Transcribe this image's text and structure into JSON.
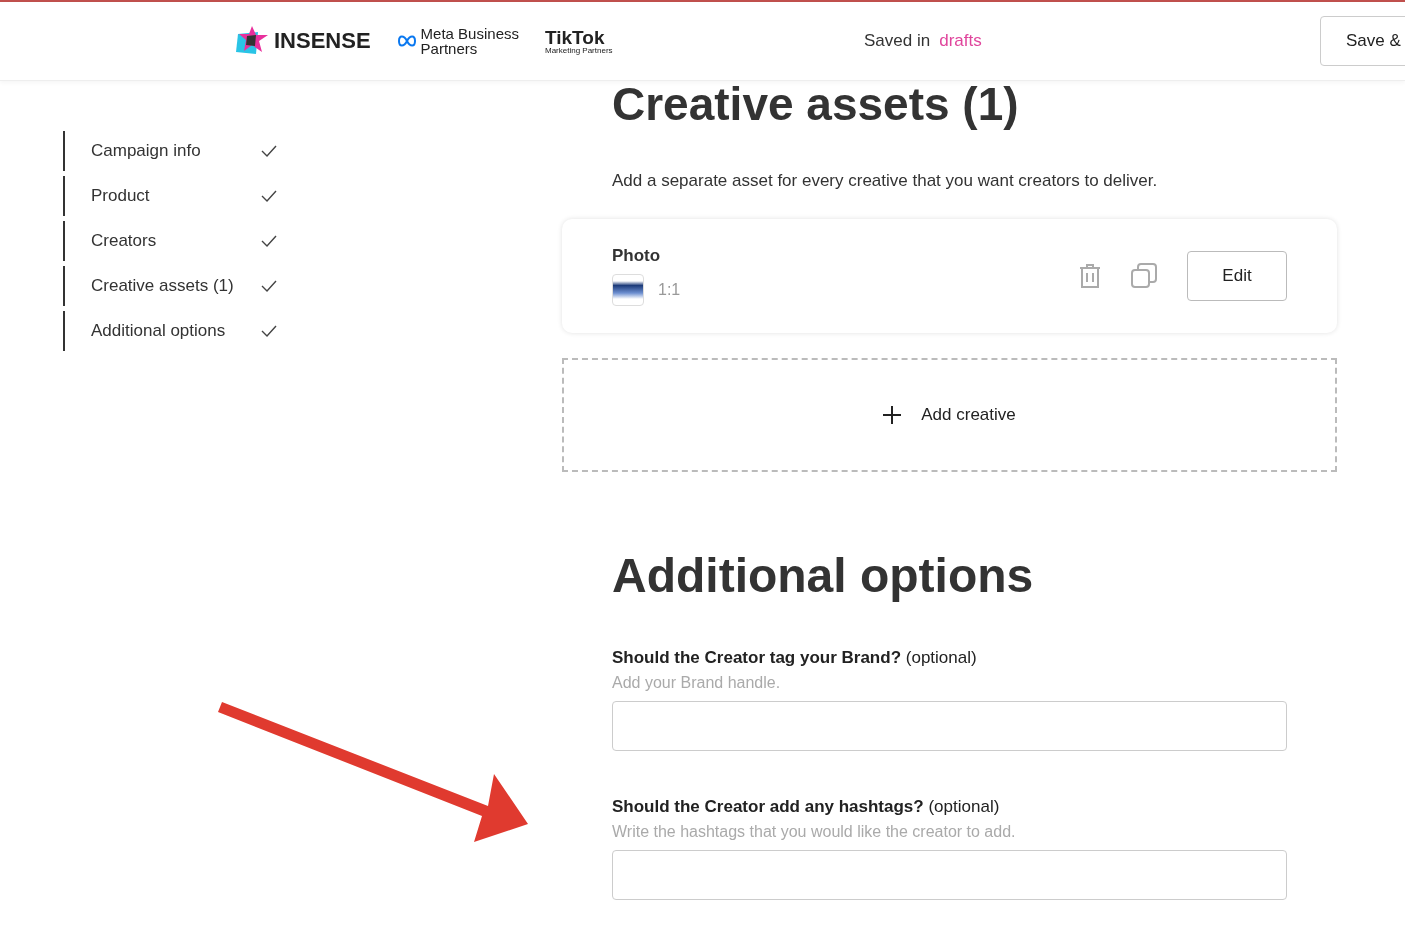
{
  "header": {
    "logos": [
      {
        "kind": "insense",
        "text": "INSENSE"
      },
      {
        "kind": "meta",
        "text": "Meta Business",
        "subtext": "Partners"
      },
      {
        "kind": "tiktok",
        "text": "TikTok",
        "subtext": "Marketing Partners"
      }
    ],
    "saved_label": "Saved in",
    "saved_link": "drafts",
    "save_button": "Save &"
  },
  "sidebar": {
    "items": [
      {
        "label": "Campaign info",
        "checked": true
      },
      {
        "label": "Product",
        "checked": true
      },
      {
        "label": "Creators",
        "checked": true
      },
      {
        "label": "Creative assets (1)",
        "checked": true
      },
      {
        "label": "Additional options",
        "checked": true
      }
    ]
  },
  "creative_assets": {
    "title": "Creative assets (1)",
    "description": "Add a separate asset for every creative that you want creators to deliver.",
    "assets": [
      {
        "type": "Photo",
        "ratio": "1:1",
        "edit_button": "Edit"
      }
    ],
    "add_button": "Add creative"
  },
  "additional_options": {
    "title": "Additional options",
    "fields": [
      {
        "label": "Should the Creator tag your Brand?",
        "optional": "(optional)",
        "hint": "Add your Brand handle."
      },
      {
        "label": "Should the Creator add any hashtags?",
        "optional": "(optional)",
        "hint": "Write the hashtags that you would like the creator to add."
      }
    ]
  }
}
